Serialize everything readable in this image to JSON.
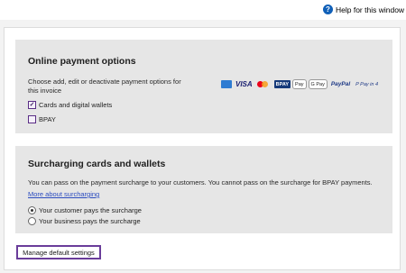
{
  "header": {
    "help_label": "Help for this window",
    "help_icon": "help-icon"
  },
  "online_payment": {
    "title": "Online payment options",
    "description": "Choose add, edit or deactivate payment options for this invoice",
    "options": [
      {
        "label": "Cards and digital wallets",
        "checked": true
      },
      {
        "label": "BPAY",
        "checked": false
      }
    ],
    "logos": [
      "AMEX",
      "VISA",
      "Mastercard",
      "BPAY",
      "Apple Pay",
      "G Pay",
      "PayPal",
      "Pay in 4"
    ],
    "logo_text": {
      "visa": "VISA",
      "bpay": "BPAY",
      "apay": "Pay",
      "gpay": "G Pay",
      "paypal": "PayPal",
      "payin4": "P Pay in 4"
    }
  },
  "surcharging": {
    "title": "Surcharging cards and wallets",
    "description": "You can pass on the payment surcharge to your customers. You cannot pass on the surcharge for BPAY payments.",
    "link": "More about surcharging",
    "options": [
      {
        "label": "Your customer pays the surcharge",
        "selected": true
      },
      {
        "label": "Your business pays the surcharge",
        "selected": false
      }
    ]
  },
  "footer": {
    "button_label": "Manage default settings"
  },
  "colors": {
    "accent": "#6a3d9a",
    "link": "#2a4bbf"
  }
}
